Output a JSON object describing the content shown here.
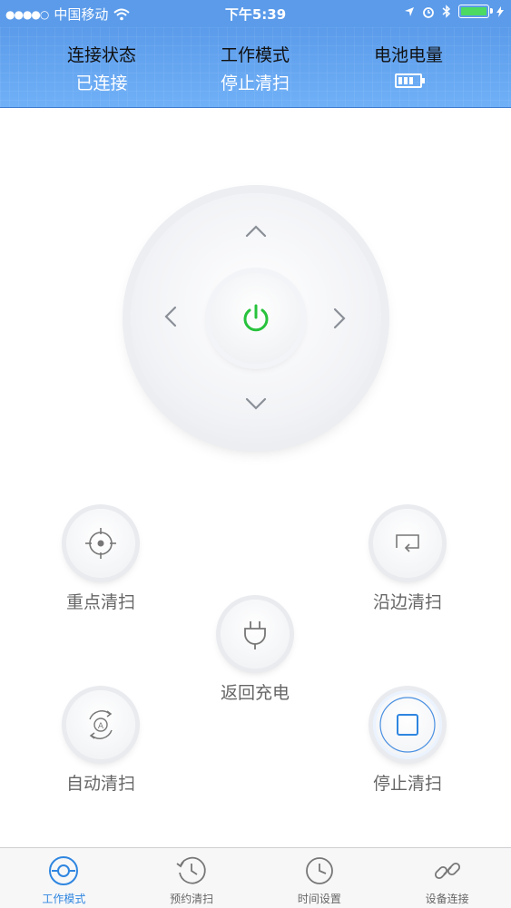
{
  "status_bar": {
    "carrier": "中国移动",
    "time": "下午5:39",
    "signal_dots": "●●●●○"
  },
  "header": {
    "connection": {
      "title": "连接状态",
      "value": "已连接"
    },
    "work_mode": {
      "title": "工作模式",
      "value": "停止清扫"
    },
    "battery": {
      "title": "电池电量",
      "level_bars": 3
    }
  },
  "modes": {
    "spot": "重点清扫",
    "edge": "沿边清扫",
    "recharge": "返回充电",
    "auto": "自动清扫",
    "stop": "停止清扫"
  },
  "tabs": [
    {
      "label": "工作模式",
      "icon": "robot-icon",
      "active": true
    },
    {
      "label": "预约清扫",
      "icon": "history-icon",
      "active": false
    },
    {
      "label": "时间设置",
      "icon": "clock-icon",
      "active": false
    },
    {
      "label": "设备连接",
      "icon": "link-icon",
      "active": false
    }
  ],
  "colors": {
    "header_blue": "#5b9bea",
    "power_green": "#27c23c",
    "accent_blue": "#2f86e0"
  }
}
